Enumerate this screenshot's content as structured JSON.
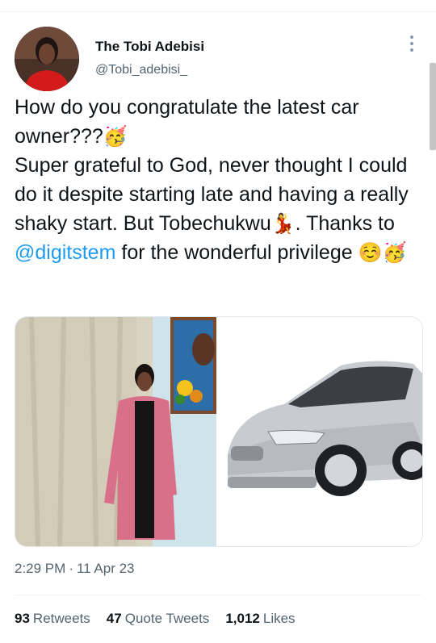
{
  "author": {
    "name": "The Tobi Adebisi",
    "handle": "@Tobi_adebisi_"
  },
  "tweet": {
    "line1": "How do you congratulate the latest car owner???",
    "line2": "Super grateful to God, never thought I could do it despite starting late and having a really shaky start. But Tobechukwu",
    "line3_pre": ". Thanks to ",
    "mention": "@digitstem",
    "line3_post": " for the wonderful privilege ",
    "emoji_party": "🥳",
    "emoji_dancer": "💃",
    "emoji_smile": "☺️"
  },
  "meta": {
    "time": "2:29 PM",
    "separator": "·",
    "date": "11 Apr 23"
  },
  "stats": {
    "retweets_count": "93",
    "retweets_label": "Retweets",
    "quotes_count": "47",
    "quotes_label": "Quote Tweets",
    "likes_count": "1,012",
    "likes_label": "Likes"
  },
  "colors": {
    "accent": "#1d9bf0",
    "secondary_text": "#536471",
    "primary_text": "#0f1419"
  }
}
